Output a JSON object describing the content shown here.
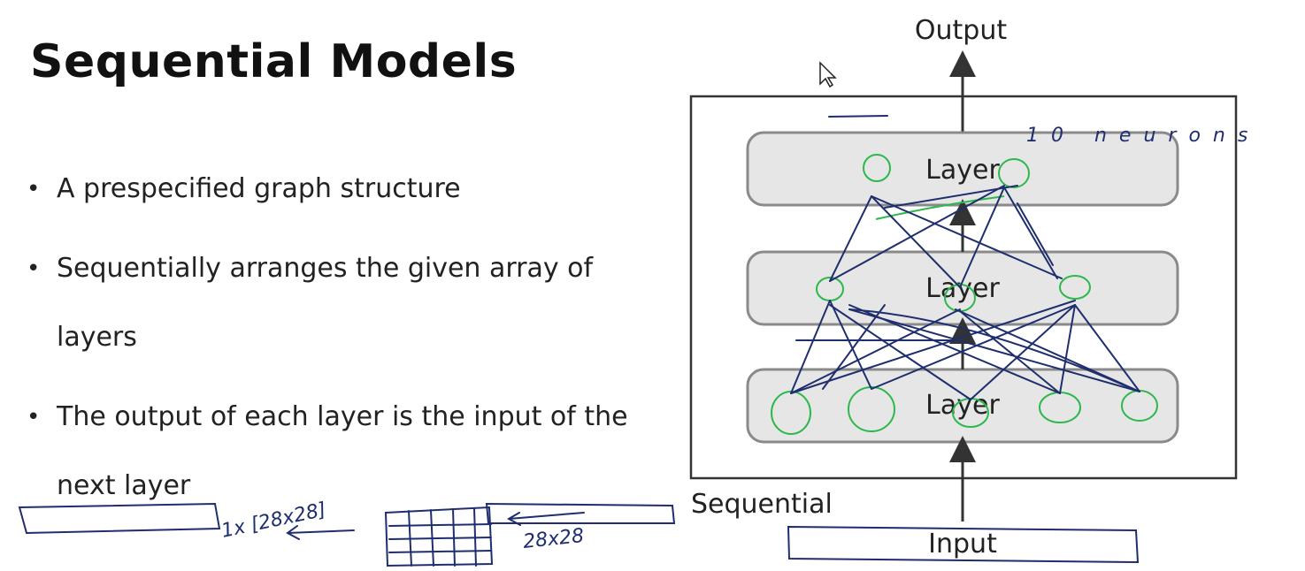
{
  "slide": {
    "title": "Sequential Models",
    "bullets": [
      "A prespecified graph structure",
      "Sequentially arranges the given array of layers",
      "The output of each layer is the input of the next layer"
    ]
  },
  "diagram": {
    "output_label": "Output",
    "input_label": "Input",
    "container_label": "Sequential",
    "layers": [
      "Layer",
      "Layer",
      "Layer"
    ]
  },
  "annotations": {
    "neurons_note": "10 neurons",
    "vector_note": "1x [28x28]",
    "grid_note": "28x28"
  },
  "colors": {
    "ink_blue": "#1f2e6e",
    "ink_green": "#2db84c",
    "layer_fill": "#e6e6e6"
  }
}
